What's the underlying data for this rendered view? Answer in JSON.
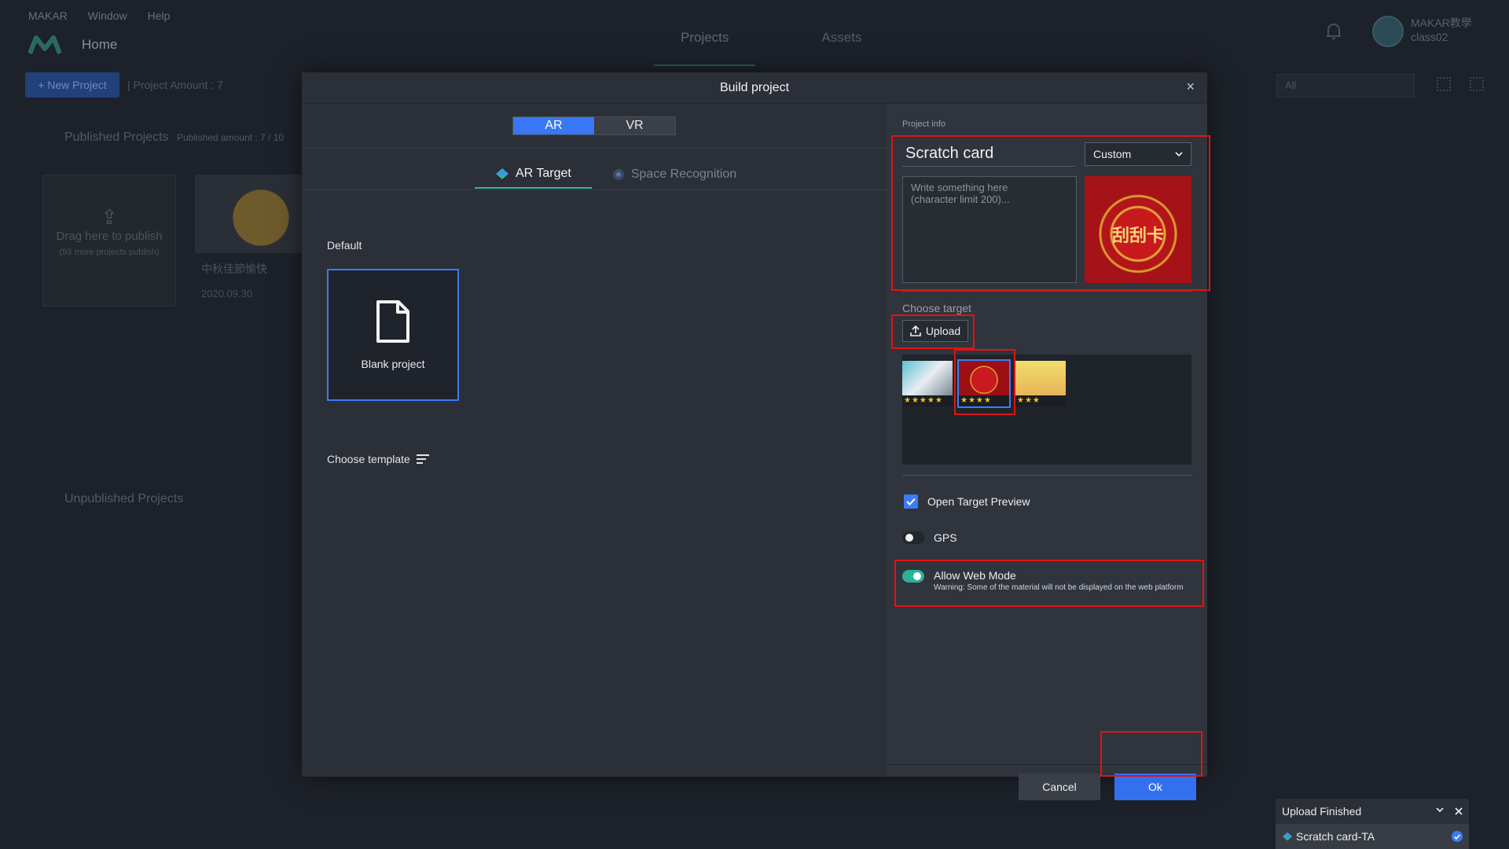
{
  "background": {
    "menu": [
      "MAKAR",
      "Window",
      "Help"
    ],
    "home": "Home",
    "top_tabs": [
      "Projects",
      "Assets"
    ],
    "user": {
      "name": "MAKAR教學",
      "sub": "class02"
    },
    "new_project": "+ New Project",
    "project_amount": "| Project Amount : 7",
    "filter": "All",
    "published_title": "Published Projects",
    "published_amount": "Published amount : 7 / 10",
    "drop_title": "Drag here to publish",
    "drop_sub": "(93 more projects publish)",
    "thumb_title": "中秋佳節愉快",
    "thumb_date": "2020.09.30",
    "unpublished_title": "Unpublished Projects"
  },
  "modal": {
    "title": "Build project",
    "close": "×",
    "mode_tabs": [
      "AR",
      "VR"
    ],
    "sub_tabs": [
      "AR Target",
      "Space Recognition"
    ],
    "default_label": "Default",
    "blank_project": "Blank project",
    "choose_template": "Choose template",
    "project_info_label": "Project info",
    "project_name": "Scratch card",
    "category": "Custom",
    "description_placeholder": "Write something here\n(character limit 200)...",
    "cover_text": "刮刮卡",
    "choose_target_label": "Choose target",
    "upload": "Upload",
    "targets": [
      {
        "stars": "★★★★★",
        "rating": 5
      },
      {
        "stars": "★★★★",
        "rating": 4
      },
      {
        "stars": "★★★",
        "rating": 3
      }
    ],
    "open_target_preview": "Open Target Preview",
    "gps": "GPS",
    "allow_web_mode": "Allow Web Mode",
    "web_warning": "Warning: Some of the material will not be displayed on the web platform",
    "cancel": "Cancel",
    "ok": "Ok"
  },
  "toast": {
    "title": "Upload Finished",
    "item": "Scratch card-TA"
  },
  "colors": {
    "accent": "#3877f5",
    "toggle_on": "#2bb39a",
    "highlight": "#e11313"
  }
}
